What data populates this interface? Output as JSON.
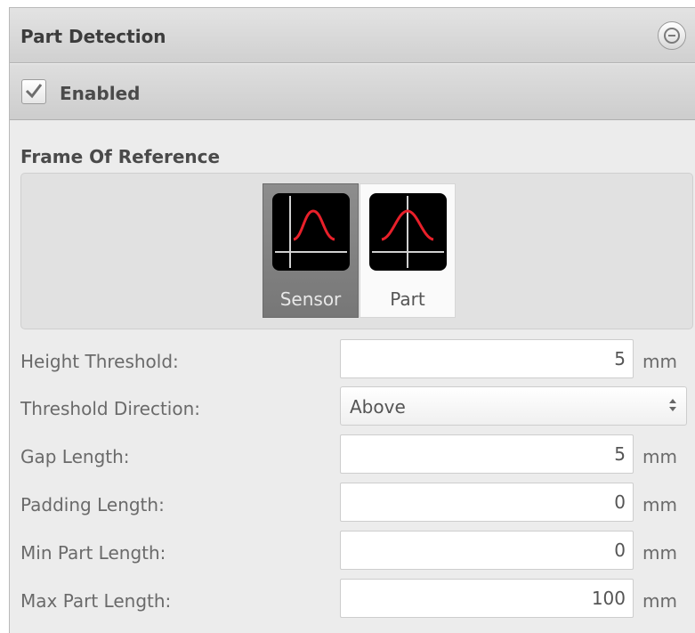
{
  "panel": {
    "title": "Part Detection",
    "enabled_label": "Enabled",
    "enabled_checked": true
  },
  "frame_of_reference": {
    "title": "Frame Of Reference",
    "options": [
      {
        "label": "Sensor",
        "icon": "sensor-profile-icon",
        "selected": true
      },
      {
        "label": "Part",
        "icon": "part-profile-icon",
        "selected": false
      }
    ]
  },
  "settings": {
    "height_threshold": {
      "label": "Height Threshold:",
      "value": "5",
      "unit": "mm"
    },
    "threshold_direction": {
      "label": "Threshold Direction:",
      "value": "Above"
    },
    "gap_length": {
      "label": "Gap Length:",
      "value": "5",
      "unit": "mm"
    },
    "padding_length": {
      "label": "Padding Length:",
      "value": "0",
      "unit": "mm"
    },
    "min_part_length": {
      "label": "Min Part Length:",
      "value": "0",
      "unit": "mm"
    },
    "max_part_length": {
      "label": "Max Part Length:",
      "value": "100",
      "unit": "mm"
    }
  },
  "colors": {
    "profile_curve": "#e8202a",
    "icon_background": "#000000",
    "selected_button": "#808080"
  }
}
